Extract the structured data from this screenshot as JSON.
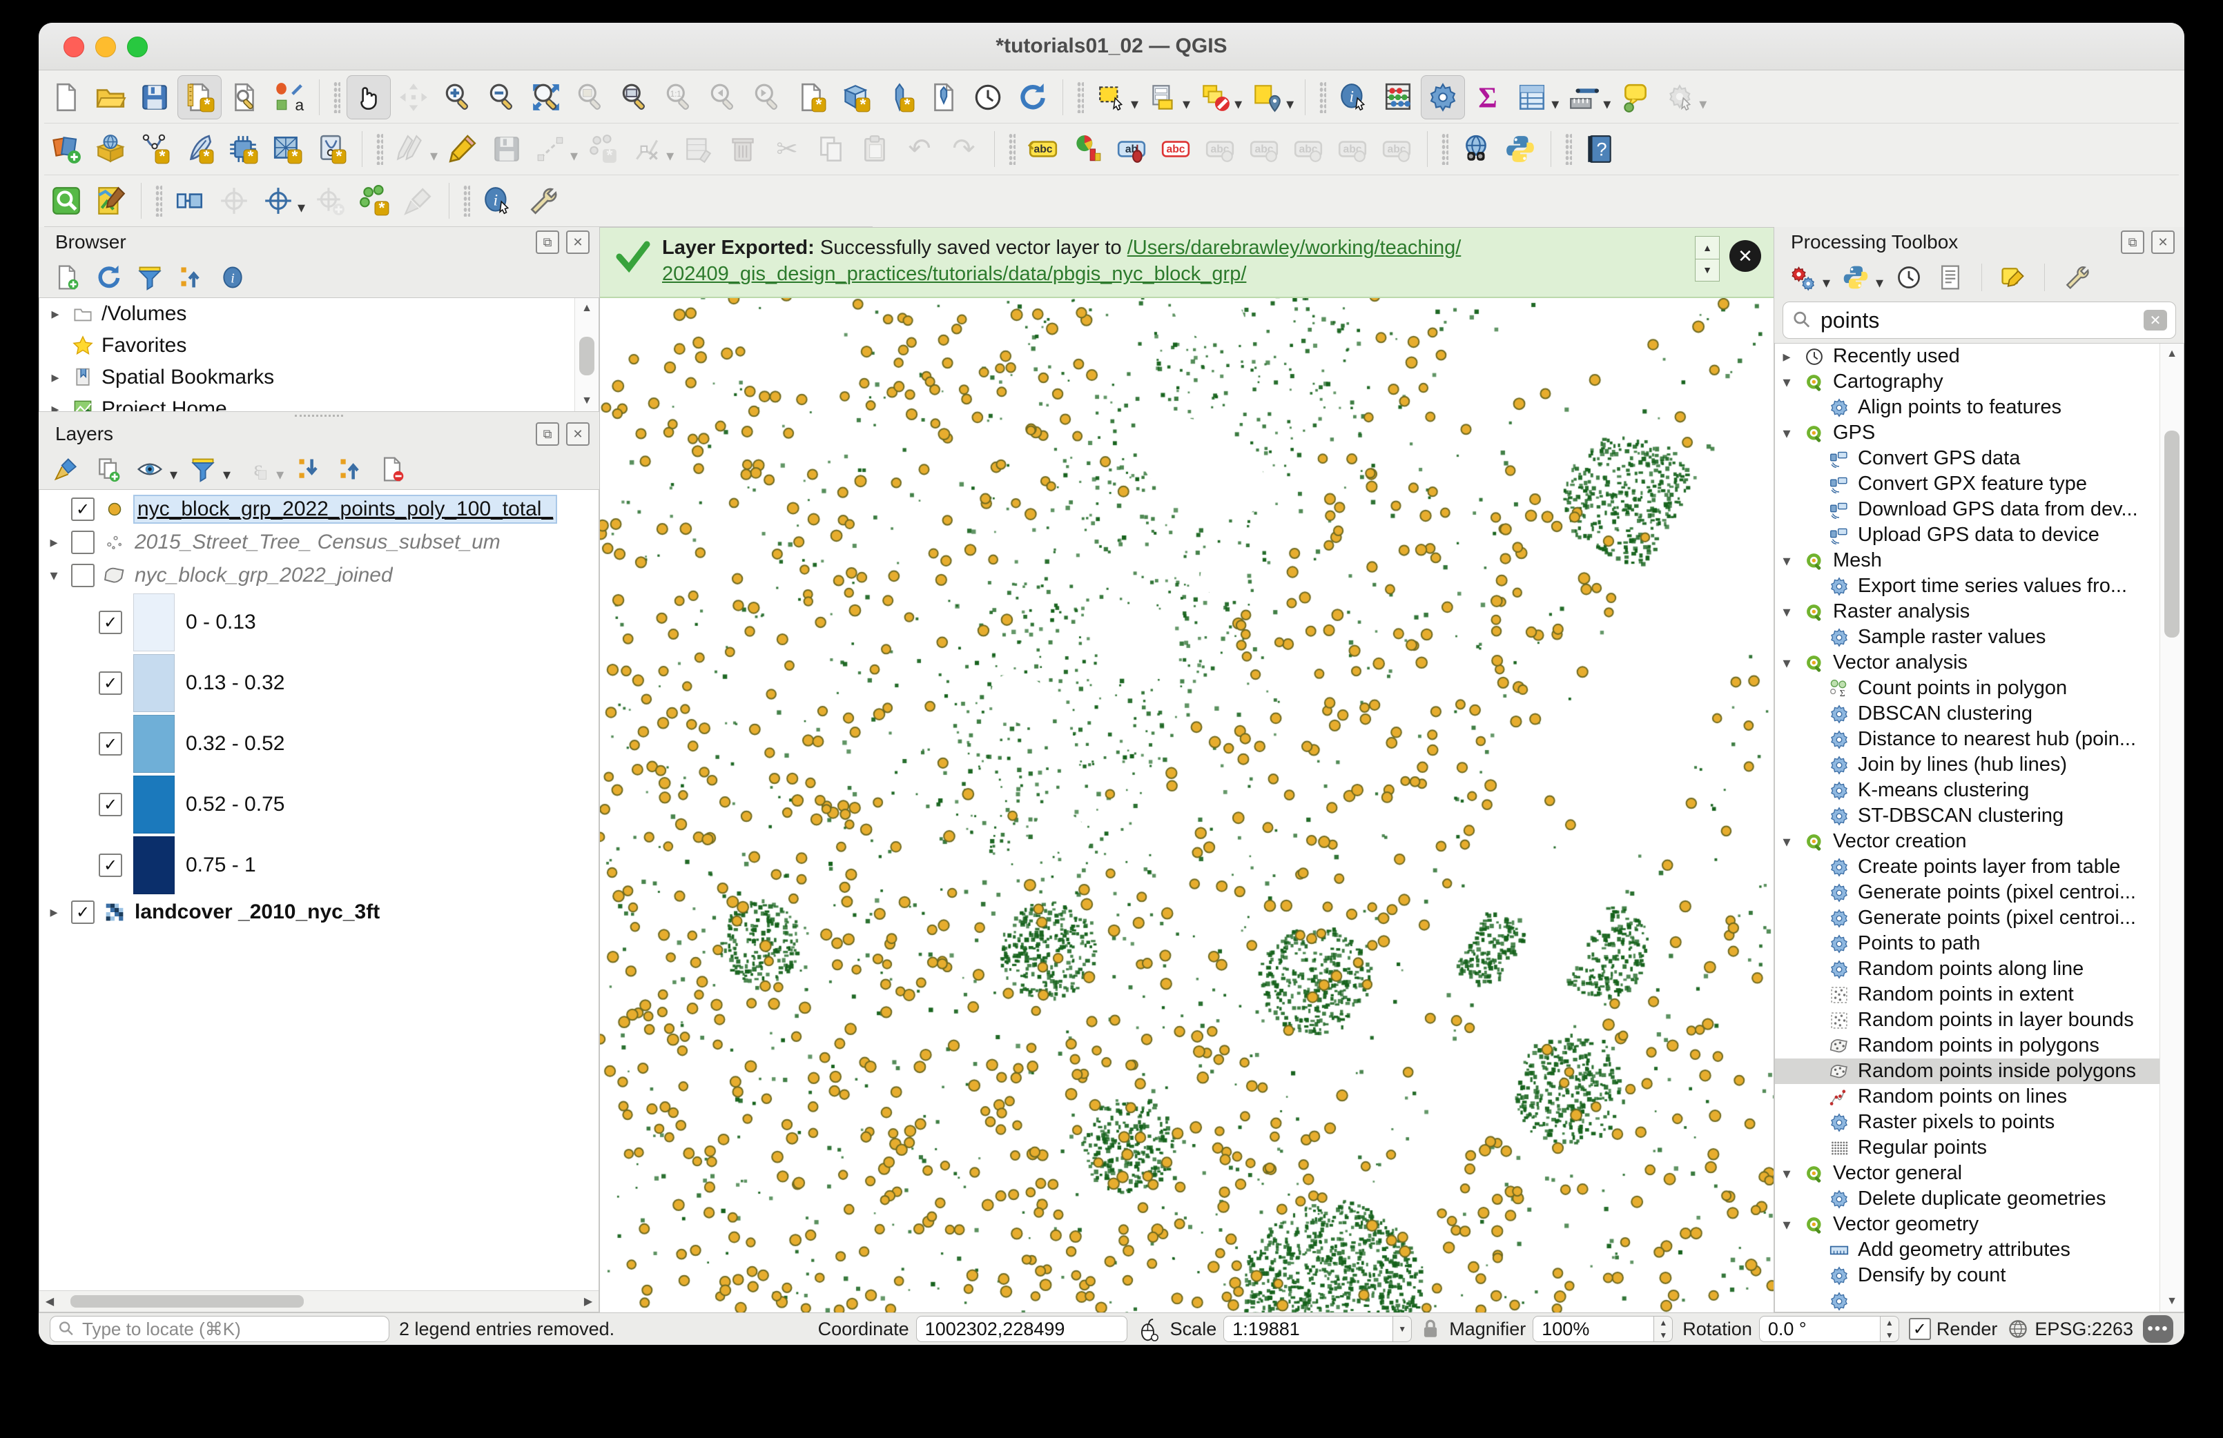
{
  "window": {
    "title": "*tutorials01_02 — QGIS"
  },
  "toolbars": {
    "row1": [
      {
        "k": "page",
        "n": "new-project"
      },
      {
        "k": "folder",
        "n": "open-project"
      },
      {
        "k": "floppy",
        "n": "save-project"
      },
      {
        "k": "layout",
        "n": "layout-manager",
        "a": 1
      },
      {
        "k": "wrenchpage",
        "n": "show-layout-manager"
      },
      {
        "k": "style",
        "n": "style-manager"
      },
      {
        "k": "SEP"
      },
      {
        "k": "hand",
        "n": "pan-map",
        "a": 1
      },
      {
        "k": "move",
        "n": "pan-to-selection",
        "d": 1
      },
      {
        "k": "magplus",
        "n": "zoom-in"
      },
      {
        "k": "magminus",
        "n": "zoom-out"
      },
      {
        "k": "magfull",
        "n": "zoom-full"
      },
      {
        "k": "magsel",
        "n": "zoom-to-selection",
        "d": 1
      },
      {
        "k": "maglayer",
        "n": "zoom-to-layer"
      },
      {
        "k": "magnative",
        "n": "zoom-native",
        "d": 1
      },
      {
        "k": "maglast",
        "n": "zoom-last",
        "d": 1
      },
      {
        "k": "magnext",
        "n": "zoom-next",
        "d": 1
      },
      {
        "k": "newmap",
        "n": "new-map-view"
      },
      {
        "k": "new3d",
        "n": "new-3d-map-view"
      },
      {
        "k": "bookmarknew",
        "n": "new-spatial-bookmark"
      },
      {
        "k": "bookmarkshow",
        "n": "show-bookmarks"
      },
      {
        "k": "clock",
        "n": "temporal-controller"
      },
      {
        "k": "refresh",
        "n": "refresh-map"
      },
      {
        "k": "SEP"
      },
      {
        "k": "selrect",
        "n": "select-features",
        "dd": 1
      },
      {
        "k": "selform",
        "n": "select-by-form",
        "dd": 1
      },
      {
        "k": "deselect",
        "n": "deselect-features",
        "dd": 1
      },
      {
        "k": "selloc",
        "n": "select-by-location",
        "dd": 1
      },
      {
        "k": "SEP"
      },
      {
        "k": "identify",
        "n": "identify-features"
      },
      {
        "k": "abacus",
        "n": "statistical-summary"
      },
      {
        "k": "gear",
        "n": "processing-toolbox-toggle",
        "a": 1
      },
      {
        "k": "sigma",
        "n": "show-statistics"
      },
      {
        "k": "tableic",
        "n": "open-attribute-table",
        "dd": 1
      },
      {
        "k": "measure",
        "n": "measure-line",
        "dd": 1
      },
      {
        "k": "maptip",
        "n": "map-tips"
      },
      {
        "k": "actiongear",
        "n": "run-feature-action",
        "d": 1,
        "dd": 1
      }
    ],
    "row2": [
      {
        "k": "layersplus",
        "n": "data-source-manager"
      },
      {
        "k": "globebox",
        "n": "new-geopackage-layer",
        "b": "*"
      },
      {
        "k": "newshp",
        "n": "new-shapefile-layer",
        "b": "*"
      },
      {
        "k": "feather",
        "n": "new-spatialite-layer",
        "b": "*"
      },
      {
        "k": "chip",
        "n": "new-virtual-layer",
        "b": "*"
      },
      {
        "k": "meshrect",
        "n": "new-mesh-layer",
        "b": "*"
      },
      {
        "k": "gpxv",
        "n": "new-gpx-layer",
        "b": "*"
      },
      {
        "k": "SEP"
      },
      {
        "k": "pencils",
        "n": "current-edits",
        "d": 1,
        "dd": 1
      },
      {
        "k": "pencily",
        "n": "toggle-editing"
      },
      {
        "k": "floppy",
        "n": "save-layer-edits",
        "d": 1
      },
      {
        "k": "segline",
        "n": "digitize-with-segment",
        "d": 1,
        "dd": 1
      },
      {
        "k": "dotsb",
        "n": "add-record",
        "d": 1
      },
      {
        "k": "vertex",
        "n": "vertex-tool",
        "d": 1,
        "dd": 1
      },
      {
        "k": "attr",
        "n": "modify-attributes",
        "d": 1
      },
      {
        "k": "trash",
        "n": "delete-selected",
        "d": 1
      },
      {
        "k": "scissors",
        "n": "cut-features",
        "d": 1
      },
      {
        "k": "copy",
        "n": "copy-features",
        "d": 1
      },
      {
        "k": "paste",
        "n": "paste-features",
        "d": 1
      },
      {
        "k": "undo",
        "n": "undo",
        "d": 1
      },
      {
        "k": "redo",
        "n": "redo",
        "d": 1
      },
      {
        "k": "SEP"
      },
      {
        "k": "tagy",
        "n": "layer-labeling"
      },
      {
        "k": "diagram",
        "n": "layer-diagram"
      },
      {
        "k": "tagb",
        "n": "pin-unpin-labels"
      },
      {
        "k": "tagr",
        "n": "highlight-pinned-labels"
      },
      {
        "k": "tagg",
        "n": "move-label",
        "d": 1
      },
      {
        "k": "tagg",
        "n": "show-hide-labels",
        "d": 1
      },
      {
        "k": "tagg",
        "n": "rotate-label",
        "d": 1
      },
      {
        "k": "tagg",
        "n": "change-label-properties",
        "d": 1
      },
      {
        "k": "tagg",
        "n": "edit-label",
        "d": 1
      },
      {
        "k": "SEP"
      },
      {
        "k": "metasearch",
        "n": "metasearch"
      },
      {
        "k": "python",
        "n": "python-console"
      },
      {
        "k": "SEP"
      },
      {
        "k": "help",
        "n": "help-contents"
      }
    ],
    "row3": [
      {
        "k": "greenmag",
        "n": "osm-place-search"
      },
      {
        "k": "mappencil",
        "n": "map-edit-plugin"
      },
      {
        "k": "SEP"
      },
      {
        "k": "panblue",
        "n": "geometry-checker"
      },
      {
        "k": "crossgray",
        "n": "gps-information",
        "d": 1
      },
      {
        "k": "crossblue",
        "n": "gps-tracking",
        "dd": 1
      },
      {
        "k": "crossplus",
        "n": "add-gps-point",
        "d": 1
      },
      {
        "k": "dotsgear",
        "n": "topology-checker"
      },
      {
        "k": "brushgray",
        "n": "clean-tool",
        "d": 1
      },
      {
        "k": "SEP"
      },
      {
        "k": "identify",
        "n": "plugin-identify"
      },
      {
        "k": "wrench",
        "n": "plugin-options"
      }
    ]
  },
  "browser_panel": {
    "title": "Browser",
    "tools": [
      {
        "k": "addpage",
        "n": "add-selected-layer"
      },
      {
        "k": "refresh",
        "n": "refresh-browser"
      },
      {
        "k": "funnel",
        "n": "filter-browser"
      },
      {
        "k": "collapseall",
        "n": "collapse-all"
      },
      {
        "k": "infocircle",
        "n": "properties-widget"
      }
    ],
    "items": [
      {
        "label": "/Volumes",
        "icon": "folder2",
        "expandable": true
      },
      {
        "label": "Favorites",
        "icon": "star",
        "expandable": false
      },
      {
        "label": "Spatial Bookmarks",
        "icon": "bookmark",
        "expandable": true
      },
      {
        "label": "Project Home",
        "icon": "maphome",
        "expandable": true
      }
    ]
  },
  "layers_panel": {
    "title": "Layers",
    "tools": [
      {
        "k": "brushic",
        "n": "open-layer-styling"
      },
      {
        "k": "addgroup",
        "n": "add-group"
      },
      {
        "k": "eye",
        "n": "manage-map-themes",
        "dd": 1
      },
      {
        "k": "funnel",
        "n": "filter-legend",
        "dd": 1
      },
      {
        "k": "epsilon",
        "n": "filter-by-expression",
        "d": 1,
        "dd": 1
      },
      {
        "k": "expandall",
        "n": "expand-all"
      },
      {
        "k": "collapseall2",
        "n": "collapse-all-layers"
      },
      {
        "k": "removepage",
        "n": "remove-layer"
      }
    ],
    "layers": [
      {
        "label": "nyc_block_grp_2022_points_poly_100_total_",
        "checked": true,
        "selected": true,
        "symbol": "pointsym"
      },
      {
        "label": "2015_Street_Tree_ Census_subset_um",
        "checked": false,
        "italic": true,
        "symbol": "treepts",
        "expandable": true
      },
      {
        "label": "nyc_block_grp_2022_joined",
        "checked": false,
        "italic": true,
        "symbol": "polyblob",
        "expanded": true
      },
      {
        "label": "landcover _2010_nyc_3ft",
        "checked": true,
        "bold": true,
        "symbol": "raster",
        "expandable": true
      }
    ],
    "classes": [
      {
        "color": "#e9f1fa",
        "label": "0 - 0.13"
      },
      {
        "color": "#c6dbef",
        "label": "0.13 - 0.32"
      },
      {
        "color": "#6fafd7",
        "label": "0.32 - 0.52"
      },
      {
        "color": "#1b79bc",
        "label": "0.52 - 0.75"
      },
      {
        "color": "#0b2f6b",
        "label": "0.75 - 1"
      }
    ]
  },
  "notification": {
    "title": "Layer Exported:",
    "message": " Successfully saved vector layer to ",
    "link_line1": "/Users/darebrawley/working/teaching/",
    "link_line2": "202409_gis_design_practices/tutorials/data/pbgis_nyc_block_grp/"
  },
  "processing_panel": {
    "title": "Processing Toolbox",
    "tools": [
      {
        "k": "gearsrb",
        "n": "toolbox-modes",
        "dd": 1
      },
      {
        "k": "python",
        "n": "python-algorithms",
        "dd": 1
      },
      {
        "k": "clock",
        "n": "history"
      },
      {
        "k": "logfile",
        "n": "results-viewer"
      },
      {
        "k": "SEP"
      },
      {
        "k": "editplace",
        "n": "edit-features-in-place"
      },
      {
        "k": "SEP"
      },
      {
        "k": "wrench",
        "n": "processing-options"
      }
    ],
    "search_value": "points",
    "tree": [
      {
        "icon": "clock",
        "label": "Recently used",
        "group": true,
        "collapsed": true
      },
      {
        "icon": "q",
        "label": "Cartography",
        "group": true
      },
      {
        "icon": "cog",
        "label": "Align points to features"
      },
      {
        "icon": "q",
        "label": "GPS",
        "group": true
      },
      {
        "icon": "gps",
        "label": "Convert GPS data"
      },
      {
        "icon": "gps",
        "label": "Convert GPX feature type"
      },
      {
        "icon": "gps",
        "label": "Download GPS data from dev..."
      },
      {
        "icon": "gps",
        "label": "Upload GPS data to device"
      },
      {
        "icon": "q",
        "label": "Mesh",
        "group": true
      },
      {
        "icon": "cog",
        "label": "Export time series values fro..."
      },
      {
        "icon": "q",
        "label": "Raster analysis",
        "group": true
      },
      {
        "icon": "cog",
        "label": "Sample raster values"
      },
      {
        "icon": "q",
        "label": "Vector analysis",
        "group": true
      },
      {
        "icon": "countpts",
        "label": "Count points in polygon"
      },
      {
        "icon": "cog",
        "label": "DBSCAN clustering"
      },
      {
        "icon": "cog",
        "label": "Distance to nearest hub (poin..."
      },
      {
        "icon": "cog",
        "label": "Join by lines (hub lines)"
      },
      {
        "icon": "cog",
        "label": "K-means clustering"
      },
      {
        "icon": "cog",
        "label": "ST-DBSCAN clustering"
      },
      {
        "icon": "q",
        "label": "Vector creation",
        "group": true
      },
      {
        "icon": "cog",
        "label": "Create points layer from table"
      },
      {
        "icon": "cog",
        "label": "Generate points (pixel centroi..."
      },
      {
        "icon": "cog",
        "label": "Generate points (pixel centroi..."
      },
      {
        "icon": "cog",
        "label": "Points to path"
      },
      {
        "icon": "cog",
        "label": "Random points along line"
      },
      {
        "icon": "dotrect",
        "label": "Random points in extent"
      },
      {
        "icon": "dotrect",
        "label": "Random points in layer bounds"
      },
      {
        "icon": "polyblob2",
        "label": "Random points in polygons"
      },
      {
        "icon": "polyblob2",
        "label": "Random points inside polygons",
        "selected": true
      },
      {
        "icon": "redline",
        "label": "Random points on lines"
      },
      {
        "icon": "cog",
        "label": "Raster pixels to points"
      },
      {
        "icon": "griddots",
        "label": "Regular points"
      },
      {
        "icon": "q",
        "label": "Vector general",
        "group": true
      },
      {
        "icon": "cog",
        "label": "Delete duplicate geometries"
      },
      {
        "icon": "q",
        "label": "Vector geometry",
        "group": true
      },
      {
        "icon": "rulericon",
        "label": "Add geometry attributes"
      },
      {
        "icon": "cog",
        "label": "Densify by count"
      },
      {
        "icon": "cog",
        "label": ""
      }
    ]
  },
  "statusbar": {
    "locate_placeholder": "Type to locate (⌘K)",
    "message": "2 legend entries removed.",
    "coordinate_label": "Coordinate",
    "coordinate_value": "1002302,228499",
    "scale_label": "Scale",
    "scale_value": "1:19881",
    "magnifier_label": "Magnifier",
    "magnifier_value": "100%",
    "rotation_label": "Rotation",
    "rotation_value": "0.0 °",
    "render_label": "Render",
    "crs_label": "EPSG:2263",
    "chat_glyph": "•••"
  },
  "map": {
    "land_green": "#14611a",
    "dot_fill": "#e7ad2e",
    "dot_stroke": "#6f6a1e",
    "water": "#ffffff",
    "rotation_deg": 29,
    "seed": 42
  }
}
